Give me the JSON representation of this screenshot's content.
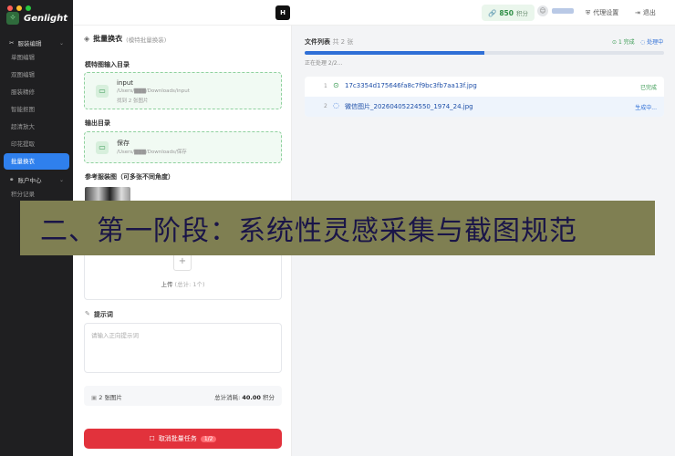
{
  "app": {
    "name": "Genlight",
    "logo_glyph": "✧"
  },
  "sidebar": {
    "group1": {
      "label": "服装编辑",
      "items": [
        "单图编辑",
        "双图编辑",
        "服装精修",
        "智能抠图",
        "超清放大",
        "印花提取",
        "批量换衣"
      ],
      "active_index": 6
    },
    "group2": {
      "label": "账户中心",
      "items": [
        "积分记录"
      ]
    }
  },
  "topbar": {
    "h_badge": "H",
    "points_value": "850",
    "points_unit": "积分",
    "proxy_label": "代理设置",
    "logout_label": "退出"
  },
  "left": {
    "title": "批量换衣",
    "subtitle": "(模特批量换装)",
    "input_dir_label": "模特图输入目录",
    "input_dir": {
      "name": "input",
      "path": "/Users/▇▇▇/Downloads/input",
      "note": "找到 2 张图片"
    },
    "output_dir_label": "输出目录",
    "output_dir": {
      "name": "保存",
      "path": "/Users/▇▇▇/Downloads/保存"
    },
    "ref_label": "参考服装图（可多张不同角度）",
    "upload_label": "上传",
    "upload_count": "(总计: 1个)",
    "prompt_label": "提示词",
    "prompt_placeholder": "请输入正向提示词",
    "summary_images": "2 张图片",
    "summary_cost_label": "总计消耗:",
    "summary_cost_value": "40.00",
    "summary_cost_unit": "积分",
    "cancel_label": "取消批量任务",
    "cancel_progress": "1/2"
  },
  "right": {
    "list_title": "文件列表",
    "list_count": "共 2 张",
    "done_stat": "1 完成",
    "processing_stat": "处理中",
    "progress_fraction": 0.5,
    "processing_text": "正在处理 2/2...",
    "files": [
      {
        "index": "1",
        "name": "17c3354d175646fa8c7f9bc3fb7aa13f.jpg",
        "status": "已完成"
      },
      {
        "index": "2",
        "name": "微信图片_20260405224550_1974_24.jpg",
        "status": "生成中..."
      }
    ]
  },
  "banner": {
    "text": "二、第一阶段：系统性灵感采集与截图规范"
  },
  "colors": {
    "accent": "#2f80ed",
    "success": "#3a9a53",
    "danger": "#e2323c",
    "banner_bg": "#7f7f52",
    "banner_text": "#1a1548"
  }
}
